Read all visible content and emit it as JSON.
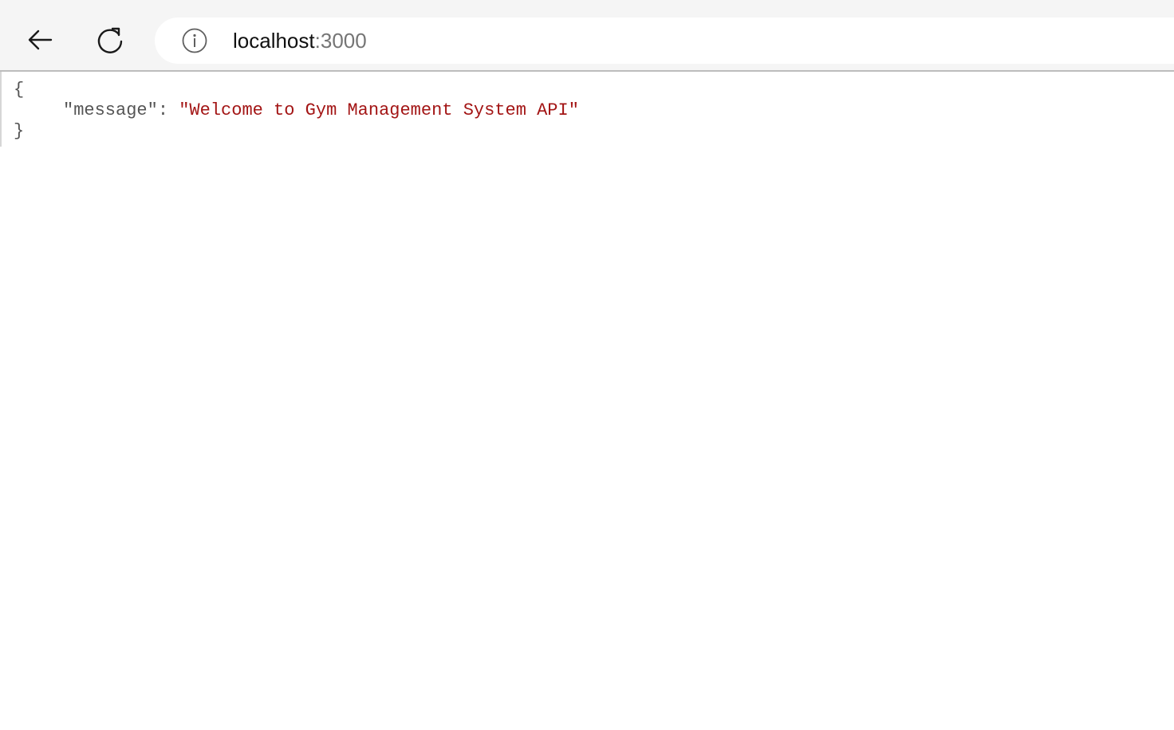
{
  "browser": {
    "back_label": "Back",
    "reload_label": "Reload",
    "site_info_label": "View site information",
    "url": {
      "host": "localhost",
      "port_separator": ":",
      "port": "3000"
    }
  },
  "json_viewer": {
    "open_brace": "{",
    "close_brace": "}",
    "entries": [
      {
        "key": "\"message\"",
        "separator": ": ",
        "value": "\"Welcome to Gym Management System API\""
      }
    ]
  },
  "colors": {
    "toolbar_bg": "#f5f5f5",
    "json_key": "#555555",
    "json_string": "#a31515"
  }
}
